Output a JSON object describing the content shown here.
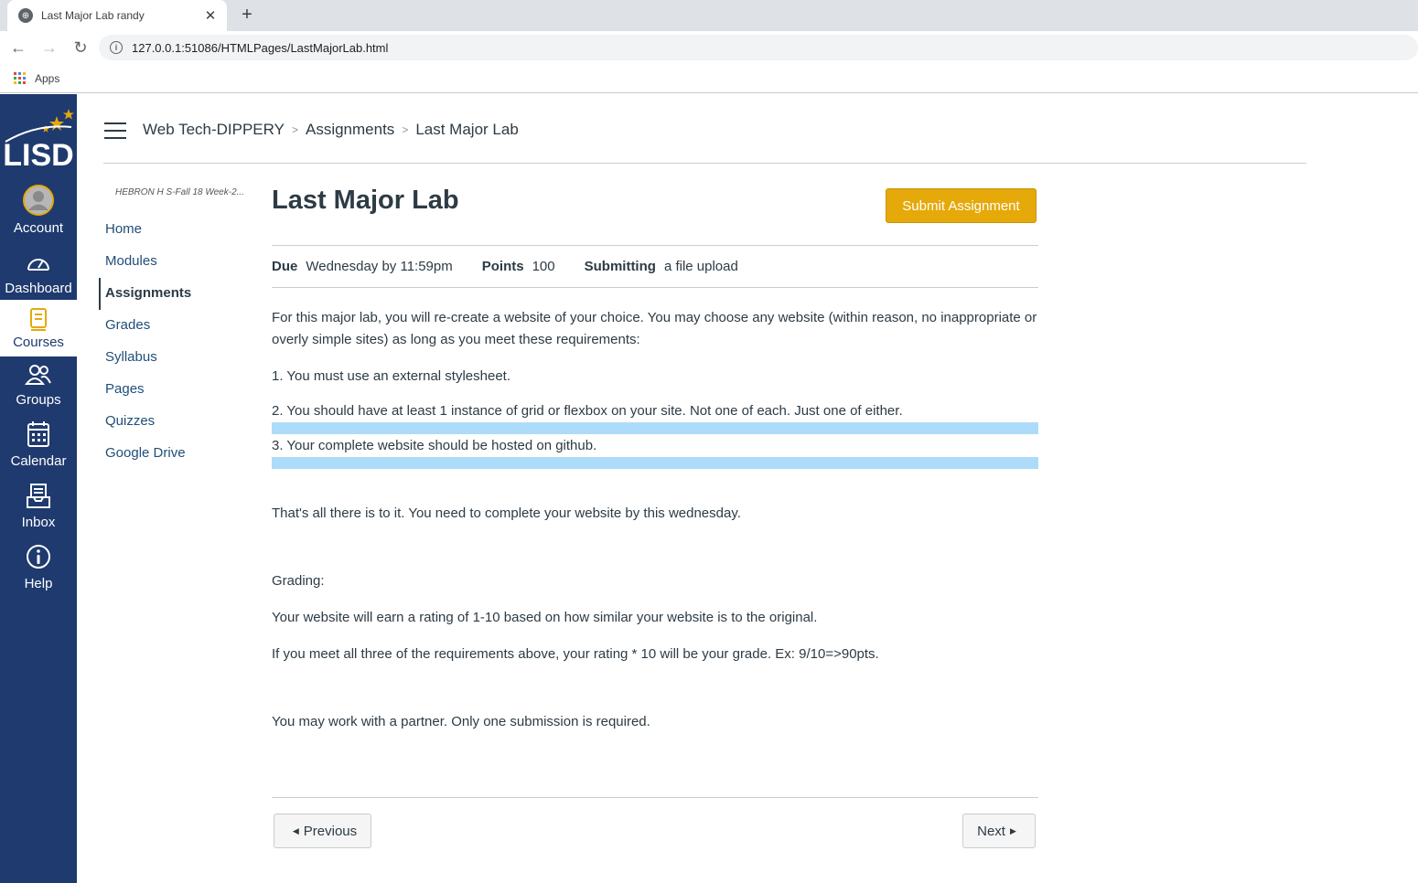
{
  "browser": {
    "tab_title": "Last Major Lab randy",
    "url": "127.0.0.1:51086/HTMLPages/LastMajorLab.html",
    "bookmark_apps": "Apps"
  },
  "global_nav": {
    "logo_text": "LISD",
    "items": [
      {
        "label": "Account",
        "icon": "account-icon"
      },
      {
        "label": "Dashboard",
        "icon": "dashboard-icon"
      },
      {
        "label": "Courses",
        "icon": "courses-icon"
      },
      {
        "label": "Groups",
        "icon": "groups-icon"
      },
      {
        "label": "Calendar",
        "icon": "calendar-icon"
      },
      {
        "label": "Inbox",
        "icon": "inbox-icon"
      },
      {
        "label": "Help",
        "icon": "help-icon"
      }
    ],
    "colors": {
      "background": "#1f3a6e",
      "accent": "#e5a90a"
    }
  },
  "breadcrumb": {
    "course": "Web Tech-DIPPERY",
    "section": "Assignments",
    "page": "Last Major Lab"
  },
  "course_nav": {
    "term": "HEBRON H S-Fall 18 Week-2...",
    "items": [
      "Home",
      "Modules",
      "Assignments",
      "Grades",
      "Syllabus",
      "Pages",
      "Quizzes",
      "Google Drive"
    ],
    "active": "Assignments"
  },
  "assignment": {
    "title": "Last Major Lab",
    "submit_label": "Submit Assignment",
    "due_label": "Due",
    "due_value": "Wednesday by 11:59pm",
    "points_label": "Points",
    "points_value": "100",
    "submitting_label": "Submitting",
    "submitting_value": "a file upload",
    "description": {
      "intro": "For this major lab, you will re-create a website of your choice. You may choose any website (within reason, no inappropriate or overly simple sites) as long as you meet these requirements:",
      "req1": "1. You must use an external stylesheet.",
      "req2": "2. You should have at least 1 instance of grid or flexbox on your site. Not one of each. Just one of either.",
      "req3": "3. Your complete website should be hosted on github.",
      "closing": "That's all there is to it. You need to complete your website by this wednesday.",
      "grading_heading": "Grading:",
      "grading1": "Your website will earn a rating of 1-10 based on how similar your website is to the original.",
      "grading2": "If you meet all three of the requirements above, your rating * 10 will be your grade. Ex: 9/10=>90pts.",
      "partner": "You may work with a partner. Only one submission is required."
    }
  },
  "pager": {
    "previous": "Previous",
    "next": "Next"
  }
}
